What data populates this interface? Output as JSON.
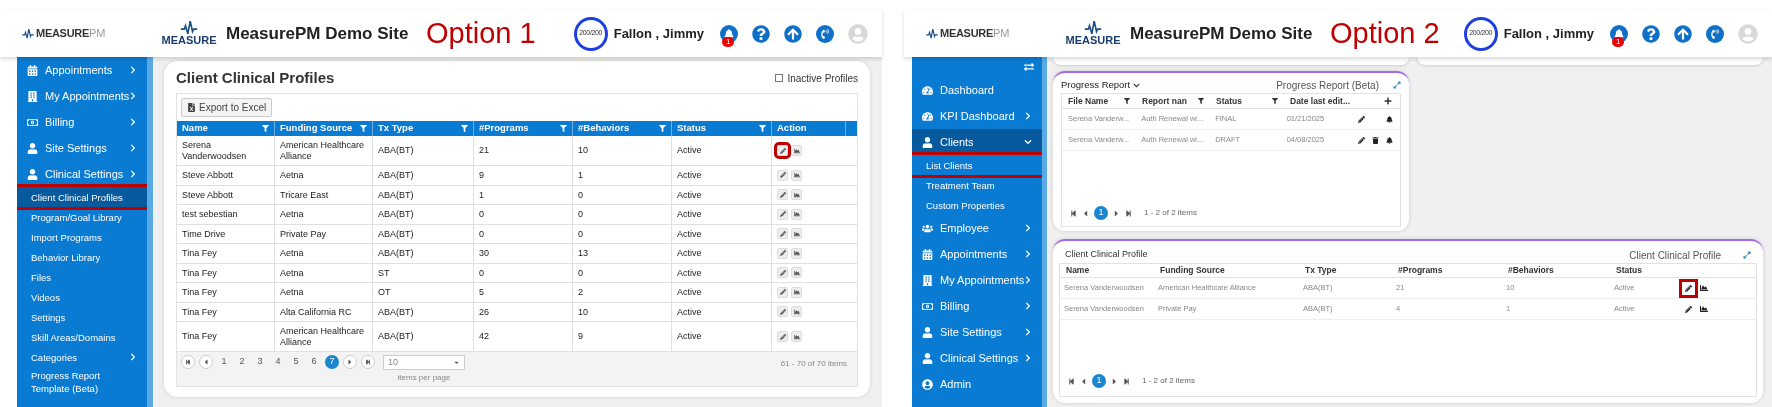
{
  "option1": {
    "header": {
      "brand_main": "MEASURE",
      "brand_suffix": "PM",
      "logo_text": "MEASURE",
      "site_title": "MeasurePM Demo Site",
      "option_label": "Option 1",
      "quota": "200/200",
      "user": "Fallon , Jimmy",
      "notification_count": "1"
    },
    "sidebar": {
      "items": [
        {
          "label": "Appointments",
          "has_submenu": true,
          "expanded": false,
          "selected": false,
          "highlighted": false
        },
        {
          "label": "My Appointments",
          "has_submenu": true,
          "expanded": false,
          "selected": false,
          "highlighted": false
        },
        {
          "label": "Billing",
          "has_submenu": true,
          "expanded": false,
          "selected": false,
          "highlighted": false
        },
        {
          "label": "Site Settings",
          "has_submenu": true,
          "expanded": false,
          "selected": false,
          "highlighted": false
        },
        {
          "label": "Clinical Settings",
          "has_submenu": true,
          "expanded": false,
          "selected": false,
          "highlighted": false,
          "children": [
            {
              "label": "Client Clinical Profiles",
              "has_submenu": false,
              "selected": true,
              "highlighted": true
            },
            {
              "label": "Program/Goal Library",
              "has_submenu": false,
              "selected": false,
              "highlighted": false
            },
            {
              "label": "Import Programs",
              "has_submenu": false,
              "selected": false,
              "highlighted": false
            },
            {
              "label": "Behavior Library",
              "has_submenu": false,
              "selected": false,
              "highlighted": false
            },
            {
              "label": "Files",
              "has_submenu": false,
              "selected": false,
              "highlighted": false
            },
            {
              "label": "Videos",
              "has_submenu": false,
              "selected": false,
              "highlighted": false
            },
            {
              "label": "Settings",
              "has_submenu": false,
              "selected": false,
              "highlighted": false
            },
            {
              "label": "Skill Areas/Domains",
              "has_submenu": false,
              "selected": false,
              "highlighted": false
            },
            {
              "label": "Categories",
              "has_submenu": true,
              "expanded": false,
              "selected": false,
              "highlighted": false
            },
            {
              "label": "Progress Report Template (Beta)",
              "has_submenu": false,
              "selected": false,
              "highlighted": false
            }
          ]
        }
      ]
    },
    "card": {
      "title": "Client Clinical Profiles",
      "inactive_checkbox": {
        "label": "Inactive Profiles",
        "checked": false
      },
      "export_button": "Export to Excel",
      "table": {
        "columns": [
          {
            "label": "Name",
            "filter": true
          },
          {
            "label": "Funding Source",
            "filter": true
          },
          {
            "label": "Tx Type",
            "filter": true
          },
          {
            "label": "#Programs",
            "filter": true
          },
          {
            "label": "#Behaviors",
            "filter": true
          },
          {
            "label": "Status",
            "filter": true
          },
          {
            "label": "Action",
            "filter": false
          }
        ],
        "rows": [
          {
            "cells": [
              "Serena Vanderwoodsen",
              "American Healthcare Alliance",
              "ABA(BT)",
              "21",
              "10",
              "Active"
            ],
            "edit_highlighted": true
          },
          {
            "cells": [
              "Steve Abbott",
              "Aetna",
              "ABA(BT)",
              "9",
              "1",
              "Active"
            ],
            "edit_highlighted": false
          },
          {
            "cells": [
              "Steve Abbott",
              "Tricare East",
              "ABA(BT)",
              "1",
              "0",
              "Active"
            ],
            "edit_highlighted": false
          },
          {
            "cells": [
              "test sebestian",
              "Aetna",
              "ABA(BT)",
              "0",
              "0",
              "Active"
            ],
            "edit_highlighted": false
          },
          {
            "cells": [
              "Time Drive",
              "Private Pay",
              "ABA(BT)",
              "0",
              "0",
              "Active"
            ],
            "edit_highlighted": false
          },
          {
            "cells": [
              "Tina Fey",
              "Aetna",
              "ABA(BT)",
              "30",
              "13",
              "Active"
            ],
            "edit_highlighted": false
          },
          {
            "cells": [
              "Tina Fey",
              "Aetna",
              "ST",
              "0",
              "0",
              "Active"
            ],
            "edit_highlighted": false
          },
          {
            "cells": [
              "Tina Fey",
              "Aetna",
              "OT",
              "5",
              "2",
              "Active"
            ],
            "edit_highlighted": false
          },
          {
            "cells": [
              "Tina Fey",
              "Alta California RC",
              "ABA(BT)",
              "26",
              "10",
              "Active"
            ],
            "edit_highlighted": false
          },
          {
            "cells": [
              "Tina Fey",
              "American Healthcare Alliance",
              "ABA(BT)",
              "42",
              "9",
              "Active"
            ],
            "edit_highlighted": false
          }
        ]
      },
      "pager": {
        "pages": [
          {
            "label": "1",
            "selected": false
          },
          {
            "label": "2",
            "selected": false
          },
          {
            "label": "3",
            "selected": false
          },
          {
            "label": "4",
            "selected": false
          },
          {
            "label": "5",
            "selected": false
          },
          {
            "label": "6",
            "selected": false
          },
          {
            "label": "7",
            "selected": true
          }
        ],
        "page_size": "10",
        "page_size_label": "items per page",
        "summary": "61 - 70 of 70 items"
      }
    }
  },
  "option2": {
    "header": {
      "brand_main": "MEASURE",
      "brand_suffix": "PM",
      "logo_text": "MEASURE",
      "site_title": "MeasurePM Demo Site",
      "option_label": "Option 2",
      "quota": "200/200",
      "user": "Fallon , Jimmy",
      "notification_count": "1"
    },
    "sidebar": {
      "items": [
        {
          "label": "Dashboard",
          "has_submenu": false,
          "selected": false,
          "highlighted": false
        },
        {
          "label": "KPI Dashboard",
          "has_submenu": true,
          "expanded": false,
          "selected": false,
          "highlighted": false
        },
        {
          "label": "Clients",
          "has_submenu": true,
          "expanded": true,
          "selected": true,
          "highlighted": false,
          "children": [
            {
              "label": "List Clients",
              "has_submenu": false,
              "selected": false,
              "highlighted": true
            },
            {
              "label": "Treatment Team",
              "has_submenu": false,
              "selected": false,
              "highlighted": false
            },
            {
              "label": "Custom Properties",
              "has_submenu": false,
              "selected": false,
              "highlighted": false
            }
          ]
        },
        {
          "label": "Employee",
          "has_submenu": true,
          "expanded": false,
          "selected": false,
          "highlighted": false
        },
        {
          "label": "Appointments",
          "has_submenu": true,
          "expanded": false,
          "selected": false,
          "highlighted": false
        },
        {
          "label": "My Appointments",
          "has_submenu": true,
          "expanded": false,
          "selected": false,
          "highlighted": false
        },
        {
          "label": "Billing",
          "has_submenu": true,
          "expanded": false,
          "selected": false,
          "highlighted": false
        },
        {
          "label": "Site Settings",
          "has_submenu": true,
          "expanded": false,
          "selected": false,
          "highlighted": false
        },
        {
          "label": "Clinical Settings",
          "has_submenu": true,
          "expanded": false,
          "selected": false,
          "highlighted": false
        },
        {
          "label": "Admin",
          "has_submenu": false,
          "selected": false,
          "highlighted": false
        }
      ]
    },
    "progress_widget": {
      "dropdown": "Progress Report",
      "title": "Progress Report (Beta)",
      "columns": [
        {
          "label": "File Name",
          "filter": true
        },
        {
          "label": "Report nan",
          "filter": true
        },
        {
          "label": "Status",
          "filter": true
        },
        {
          "label": "Date last edit...",
          "filter": false
        }
      ],
      "rows": [
        {
          "cells": [
            "Serena Vanderw...",
            "Auth Renewal wi...",
            "FINAL",
            "01/21/2025"
          ],
          "actions": [
            {
              "kind": "edit"
            },
            {
              "kind": "bell"
            }
          ]
        },
        {
          "cells": [
            "Serena Vanderw...",
            "Auth Renewal wi...",
            "DRAFT",
            "04/08/2025"
          ],
          "actions": [
            {
              "kind": "edit"
            },
            {
              "kind": "delete"
            },
            {
              "kind": "bell"
            }
          ]
        }
      ],
      "pager": {
        "pages": [
          {
            "label": "1",
            "selected": true
          }
        ],
        "summary": "1 - 2 of 2 items"
      }
    },
    "clinical_widget": {
      "title": "Client Clinical Profile",
      "header_label": "Client Clinical Profile",
      "columns": [
        "Name",
        "Funding Source",
        "Tx Type",
        "#Programs",
        "#Behaviors",
        "Status"
      ],
      "rows": [
        {
          "cells": [
            "Serena Vanderwoodsen",
            "American Healthcare Alliance",
            "ABA(BT)",
            "21",
            "10",
            "Active"
          ],
          "edit_highlighted": true
        },
        {
          "cells": [
            "Serena Vanderwoodsen",
            "Private Pay",
            "ABA(BT)",
            "4",
            "1",
            "Active"
          ],
          "edit_highlighted": false
        }
      ],
      "pager": {
        "pages": [
          {
            "label": "1",
            "selected": true
          }
        ],
        "summary": "1 - 2 of 2 items"
      }
    }
  }
}
